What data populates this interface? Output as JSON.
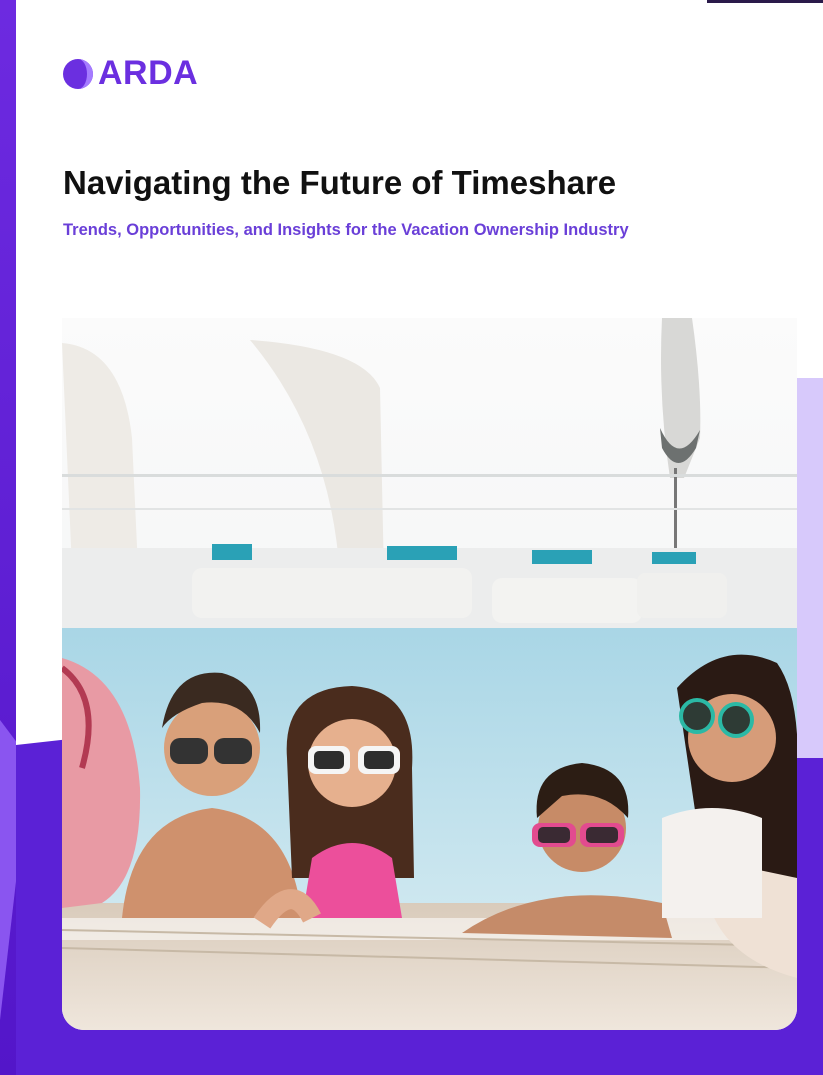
{
  "brand": {
    "name": "ARDA",
    "accent_color": "#6b2fe0",
    "frame_color": "#5b21d6"
  },
  "document": {
    "title": "Navigating the Future of Timeshare",
    "subtitle": "Trends, Opportunities, and Insights for the Vacation Ownership Industry",
    "subtitle_color": "#6a3fd8"
  },
  "cover_photo": {
    "subject": "family-in-pool-photo"
  }
}
